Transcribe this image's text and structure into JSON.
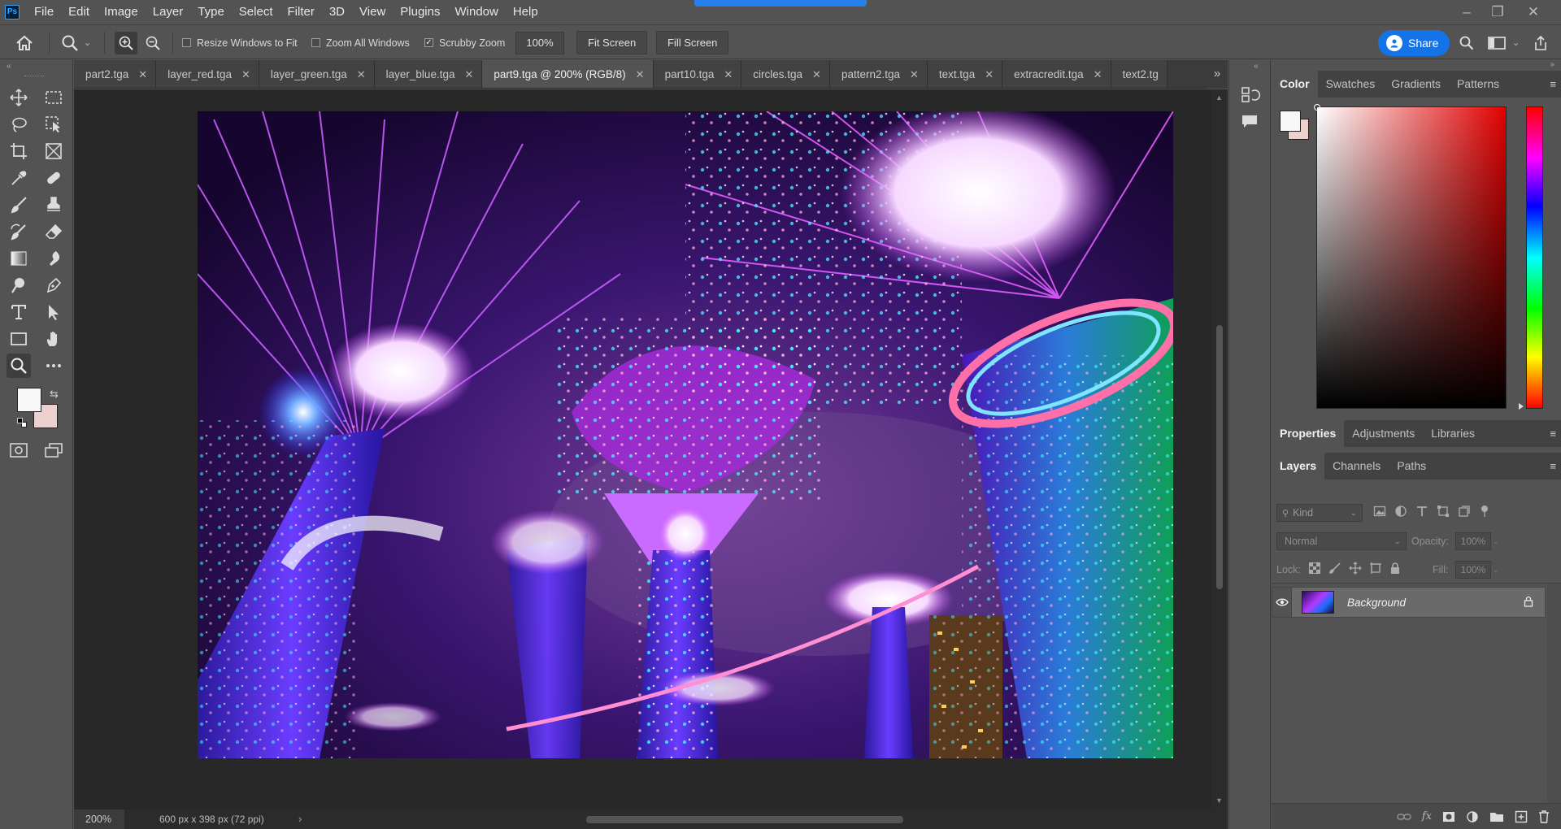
{
  "menu": {
    "logo": "Ps",
    "items": [
      "File",
      "Edit",
      "Image",
      "Layer",
      "Type",
      "Select",
      "Filter",
      "3D",
      "View",
      "Plugins",
      "Window",
      "Help"
    ]
  },
  "window_controls": {
    "minimize": "–",
    "restore": "❐",
    "close": "✕"
  },
  "options": {
    "resize_windows_label": "Resize Windows to Fit",
    "resize_windows_checked": false,
    "zoom_all_label": "Zoom All Windows",
    "zoom_all_checked": false,
    "scrubby_zoom_label": "Scrubby Zoom",
    "scrubby_zoom_checked": true,
    "zoom_value": "100%",
    "fit_screen": "Fit Screen",
    "fill_screen": "Fill Screen",
    "share_label": "Share"
  },
  "tabs": [
    {
      "label": "part2.tga",
      "active": false
    },
    {
      "label": "layer_red.tga",
      "active": false
    },
    {
      "label": "layer_green.tga",
      "active": false
    },
    {
      "label": "layer_blue.tga",
      "active": false
    },
    {
      "label": "part9.tga @ 200% (RGB/8)",
      "active": true
    },
    {
      "label": "part10.tga",
      "active": false
    },
    {
      "label": "circles.tga",
      "active": false
    },
    {
      "label": "pattern2.tga",
      "active": false
    },
    {
      "label": "text.tga",
      "active": false
    },
    {
      "label": "extracredit.tga",
      "active": false
    },
    {
      "label": "text2.tg",
      "active": false
    }
  ],
  "tab_overflow": "»",
  "status": {
    "zoom": "200%",
    "doc_info": "600 px x 398 px (72 ppi)",
    "arrow": "›"
  },
  "colors": {
    "foreground": "#f8f8f8",
    "background": "#edd1cf",
    "accent": "#1473e6"
  },
  "color_panel": {
    "tabs": [
      "Color",
      "Swatches",
      "Gradients",
      "Patterns"
    ],
    "active": "Color"
  },
  "properties_panel": {
    "tabs": [
      "Properties",
      "Adjustments",
      "Libraries"
    ],
    "active": "Properties"
  },
  "layers_panel": {
    "tabs": [
      "Layers",
      "Channels",
      "Paths"
    ],
    "active": "Layers",
    "filter_kind": "Kind",
    "blend_mode": "Normal",
    "opacity_label": "Opacity:",
    "opacity_value": "100%",
    "lock_label": "Lock:",
    "fill_label": "Fill:",
    "fill_value": "100%",
    "layers": [
      {
        "name": "Background",
        "visible": true,
        "locked": true
      }
    ]
  },
  "icons": {
    "home": "⌂",
    "zoom": "🔍︎",
    "zoom_in": "⊕",
    "zoom_out": "⊖",
    "search": "⚲",
    "eye": "👁︎",
    "lock": "🔒︎",
    "menu": "≡",
    "chevron": "⌄"
  }
}
